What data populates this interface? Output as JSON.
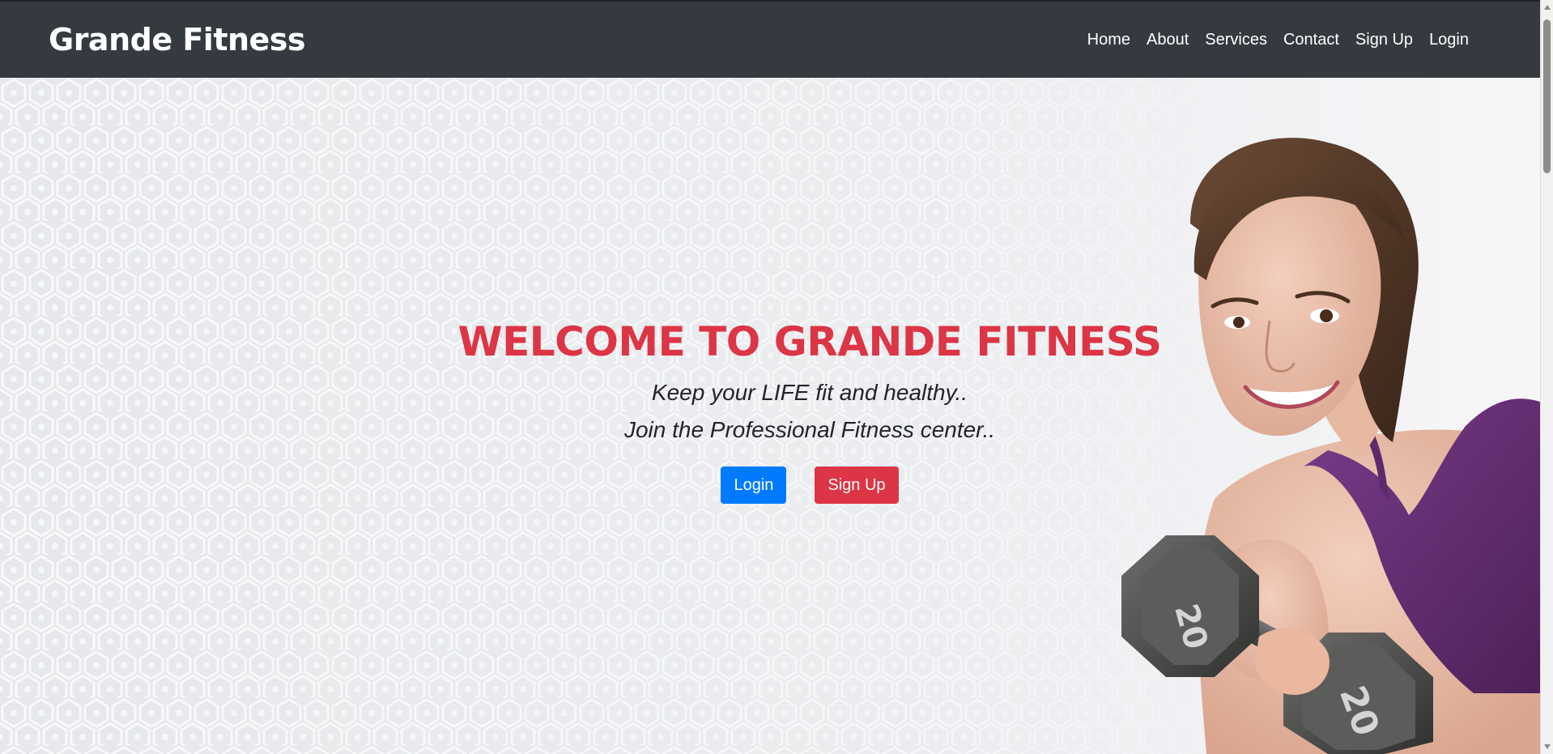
{
  "navbar": {
    "brand": "Grande Fitness",
    "links": [
      {
        "label": "Home"
      },
      {
        "label": "About"
      },
      {
        "label": "Services"
      },
      {
        "label": "Contact"
      },
      {
        "label": "Sign Up"
      },
      {
        "label": "Login"
      }
    ]
  },
  "hero": {
    "title": "WELCOME TO GRANDE FITNESS",
    "tagline_1": "Keep your LIFE fit and healthy..",
    "tagline_2": "Join the Professional Fitness center..",
    "login_button": "Login",
    "signup_button": "Sign Up",
    "dumbbell_weight_left": "20",
    "dumbbell_weight_right": "20"
  },
  "colors": {
    "navbar_bg": "#343a40",
    "accent_red": "#dc3545",
    "primary_blue": "#007bff"
  }
}
